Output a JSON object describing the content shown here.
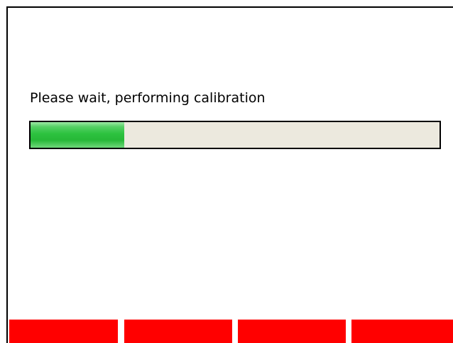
{
  "status": {
    "message": "Please wait, performing calibration",
    "progress": 0.23
  },
  "softkeys": [
    {
      "label": ""
    },
    {
      "label": ""
    },
    {
      "label": ""
    },
    {
      "label": ""
    }
  ],
  "colors": {
    "progress_fill": "#2dc23f",
    "progress_track": "#ece9de",
    "softkey": "#ff0000",
    "frame": "#000000"
  }
}
